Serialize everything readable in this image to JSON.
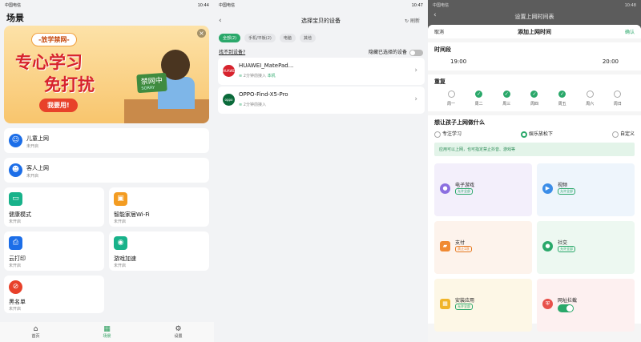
{
  "left": {
    "status": {
      "carrier": "中国电信",
      "time": "10:44"
    },
    "title": "场景",
    "banner": {
      "tag": "-放学禁网-",
      "line1": "专心学习",
      "line2": "免打扰",
      "button": "我要用!",
      "sign": "禁网中",
      "sign_sub": "SORRY"
    },
    "cards": [
      {
        "title": "儿童上网",
        "status": "未开启"
      },
      {
        "title": "客人上网",
        "status": "未开启"
      },
      {
        "title": "健康模式",
        "status": "未开启"
      },
      {
        "title": "智能家居Wi-Fi",
        "status": "未开启"
      },
      {
        "title": "云打印",
        "status": "未开启"
      },
      {
        "title": "游戏加速",
        "status": "未开启"
      },
      {
        "title": "黑名单",
        "status": "未开启"
      }
    ],
    "nav": [
      {
        "label": "首页"
      },
      {
        "label": "场景"
      },
      {
        "label": "设置"
      }
    ]
  },
  "middle": {
    "status": {
      "carrier": "中国电信",
      "time": "10:47"
    },
    "title": "选择宝贝的设备",
    "refresh": "刷新",
    "chips": [
      "全部(2)",
      "手机/平板(2)",
      "电脑",
      "其他"
    ],
    "not_found": "找不到设备?",
    "hide_selected": "隐藏已选择的设备",
    "devices": [
      {
        "name": "HUAWEI_MatePad...",
        "meta": "2分钟前接入",
        "extra": "本机",
        "logo": "HUAWEI"
      },
      {
        "name": "OPPO-Find-X5-Pro",
        "meta": "2分钟前接入",
        "extra": "",
        "logo": "oppo"
      }
    ]
  },
  "right": {
    "status": {
      "carrier": "中国电信",
      "time": "10:48"
    },
    "page_title": "设置上网时间表",
    "cancel": "取消",
    "sheet_title": "添加上网时间",
    "confirm": "确认",
    "period_label": "时间段",
    "start": "19:00",
    "end": "20:00",
    "repeat_label": "重复",
    "days": [
      {
        "label": "周一",
        "on": false
      },
      {
        "label": "周二",
        "on": true
      },
      {
        "label": "周三",
        "on": true
      },
      {
        "label": "周四",
        "on": true
      },
      {
        "label": "周五",
        "on": true
      },
      {
        "label": "周六",
        "on": false
      },
      {
        "label": "周日",
        "on": false
      }
    ],
    "purpose_label": "想让孩子上网做什么",
    "purposes": [
      "专注学习",
      "娱乐放松下",
      "自定义"
    ],
    "note": "应用可以上网，也可指定禁止抖音、游戏等",
    "apps": [
      {
        "name": "电子游戏",
        "badge": "允许全部"
      },
      {
        "name": "视频",
        "badge": "允许全部"
      },
      {
        "name": "支付",
        "badge": "禁止1项"
      },
      {
        "name": "社交",
        "badge": "允许全部"
      },
      {
        "name": "安装应用",
        "badge": "允许全部"
      },
      {
        "name": "网址拦截",
        "badge": ""
      }
    ]
  }
}
